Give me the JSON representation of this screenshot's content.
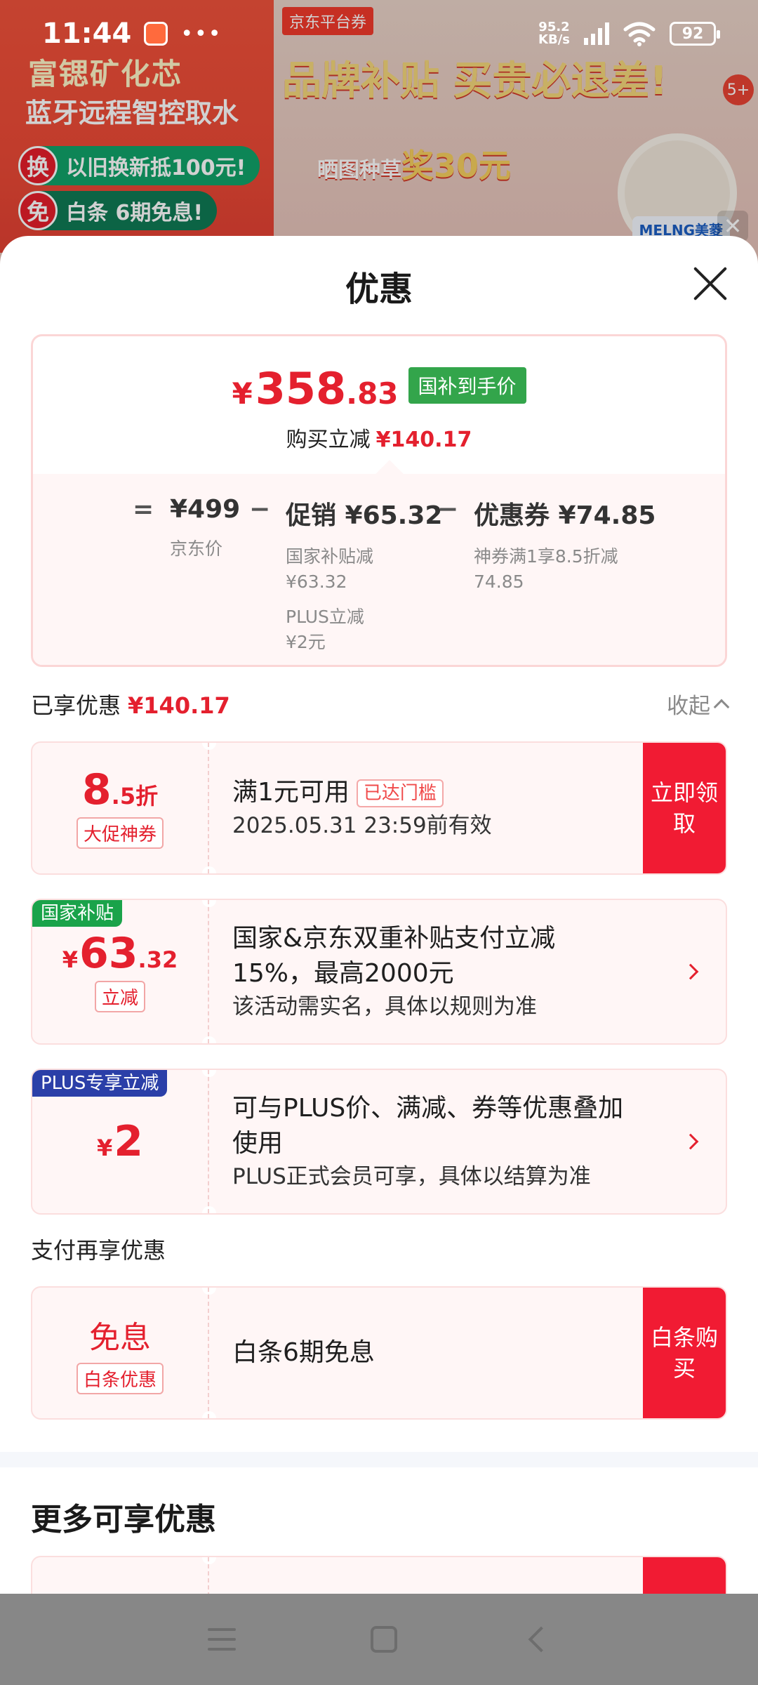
{
  "status_bar": {
    "time": "11:44",
    "dots": "•••",
    "network_speed": "95.2",
    "network_unit": "KB/s",
    "battery": "92"
  },
  "banner": {
    "left_line1": "富锶矿化芯",
    "left_line2": "蓝牙远程智控取水",
    "pill1_icon": "换",
    "pill1_text": "以旧换新抵100元!",
    "pill2_icon": "免",
    "pill2_text": "白条 6期免息!",
    "platform_tag": "京东平台券",
    "headline": "品牌补贴 买贵必退差!",
    "sub_small": "晒图种草",
    "sub_big": "奖30元",
    "badge": "5+",
    "brand": "MELNG美菱",
    "close": "✕"
  },
  "sheet": {
    "title": "优惠"
  },
  "summary": {
    "currency": "¥",
    "final_int": "358",
    "final_dec": ".83",
    "final_tag": "国补到手价",
    "reduce_label": "购买立减",
    "reduce_amount": "¥140.17",
    "eq": "=",
    "minus": "−",
    "jd_price": "¥499",
    "jd_price_label": "京东价",
    "promo": "促销 ¥65.32",
    "promo_detail1": "国家补贴减",
    "promo_detail1_amt": "¥63.32",
    "promo_detail2": "PLUS立减",
    "promo_detail2_amt": "¥2元",
    "coupon": "优惠券 ¥74.85",
    "coupon_detail": "神券满1享8.5折减",
    "coupon_detail_amt": "74.85"
  },
  "enjoyed": {
    "label": "已享优惠",
    "amount": "¥140.17",
    "collapse": "收起"
  },
  "cards": [
    {
      "val_int": "8",
      "val_dec": ".5折",
      "label": "大促神券",
      "title": "满1元可用",
      "tag": "已达门槛",
      "sub": "2025.05.31 23:59前有效",
      "action": "立即领取"
    },
    {
      "corner": "国家补贴",
      "corner_color": "#1aa34a",
      "sym": "¥",
      "val_int": "63",
      "val_dec": ".32",
      "label": "立减",
      "title": "国家&京东双重补贴支付立减15%，最高2000元",
      "sub": "该活动需实名，具体以规则为准"
    },
    {
      "corner": "PLUS专享立减",
      "corner_color": "#2b3fa8",
      "sym": "¥",
      "val_int": "2",
      "title": "可与PLUS价、满减、券等优惠叠加使用",
      "sub": "PLUS正式会员可享，具体以结算为准"
    }
  ],
  "pay_section": {
    "label": "支付再享优惠",
    "card": {
      "val": "免息",
      "label": "白条优惠",
      "title": "白条6期免息",
      "action": "白条购买"
    }
  },
  "more": {
    "title": "更多可享优惠"
  }
}
